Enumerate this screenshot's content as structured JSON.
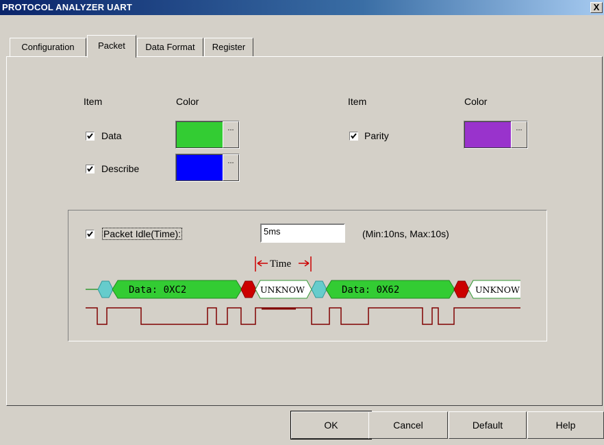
{
  "window": {
    "title": "PROTOCOL ANALYZER UART",
    "close_label": "X"
  },
  "tabs": [
    {
      "label": "Configuration",
      "active": false
    },
    {
      "label": "Packet",
      "active": true
    },
    {
      "label": "Data Format",
      "active": false
    },
    {
      "label": "Register",
      "active": false
    }
  ],
  "items": {
    "header_item_left": "Item",
    "header_color_left": "Color",
    "header_item_right": "Item",
    "header_color_right": "Color",
    "rows": [
      {
        "label": "Data",
        "checked": true,
        "color": "#33cc33"
      },
      {
        "label": "Describe",
        "checked": true,
        "color": "#0000ff"
      },
      {
        "label": "Parity",
        "checked": true,
        "color": "#9933cc"
      }
    ],
    "dots_label": "..."
  },
  "packet_idle": {
    "label": "Packet Idle(Time):",
    "checked": true,
    "value": "5ms",
    "range": "(Min:10ns, Max:10s)"
  },
  "diagram": {
    "time_label": "Time",
    "packets": [
      "Data: 0XC2",
      "UNKNOW",
      "Data: 0X62",
      "UNKNOW"
    ],
    "colors": {
      "data": "#33cc33",
      "start": "#66cccc",
      "parity": "#cc0000",
      "unknown": "#ffffff",
      "signal": "#800000"
    }
  },
  "buttons": {
    "ok": "OK",
    "cancel": "Cancel",
    "default": "Default",
    "help": "Help"
  }
}
